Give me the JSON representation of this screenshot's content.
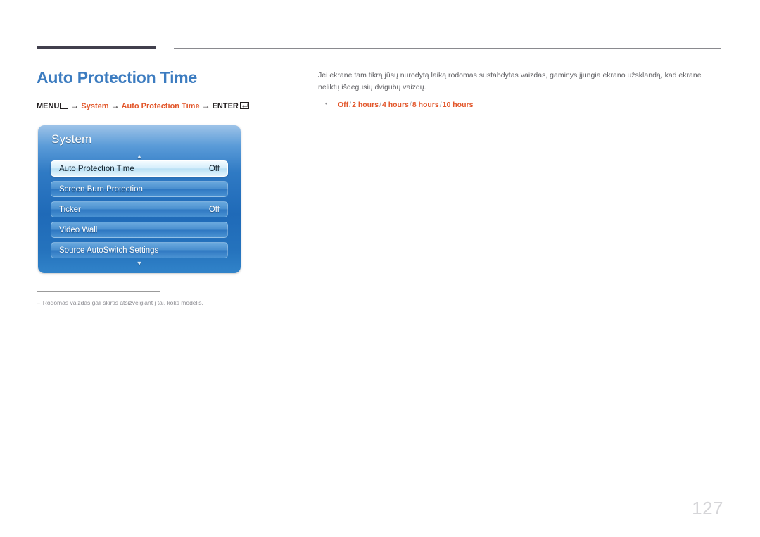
{
  "page": {
    "number": "127",
    "title": "Auto Protection Time"
  },
  "breadcrumb": {
    "menu_label": "MENU",
    "menu_icon": "menu-bars-icon",
    "arrow": "→",
    "items": [
      "System",
      "Auto Protection Time"
    ],
    "enter_label": "ENTER",
    "enter_icon": "enter-return-icon"
  },
  "osd": {
    "title": "System",
    "scroll_up_icon": "▲",
    "scroll_down_icon": "▼",
    "rows": [
      {
        "label": "Auto Protection Time",
        "value": "Off",
        "selected": true
      },
      {
        "label": "Screen Burn Protection",
        "value": "",
        "selected": false
      },
      {
        "label": "Ticker",
        "value": "Off",
        "selected": false
      },
      {
        "label": "Video Wall",
        "value": "",
        "selected": false
      },
      {
        "label": "Source AutoSwitch Settings",
        "value": "",
        "selected": false
      }
    ]
  },
  "footnote": {
    "dash": "–",
    "text": "Rodomas vaizdas gali skirtis atsižvelgiant į tai, koks modelis."
  },
  "content": {
    "paragraph": "Jei ekrane tam tikrą jūsų nurodytą laiką rodomas sustabdytas vaizdas, gaminys įjungia ekrano užsklandą, kad ekrane neliktų išdegusių dvigubų vaizdų.",
    "options": [
      "Off",
      "2 hours",
      "4 hours",
      "8 hours",
      "10 hours"
    ],
    "options_separator": "/"
  },
  "colors": {
    "title_blue": "#3c7cc0",
    "accent_orange": "#e2562a",
    "rule_dark": "#413f4d",
    "body_gray": "#5f5f63",
    "page_number_gray": "#d5d5d8"
  }
}
